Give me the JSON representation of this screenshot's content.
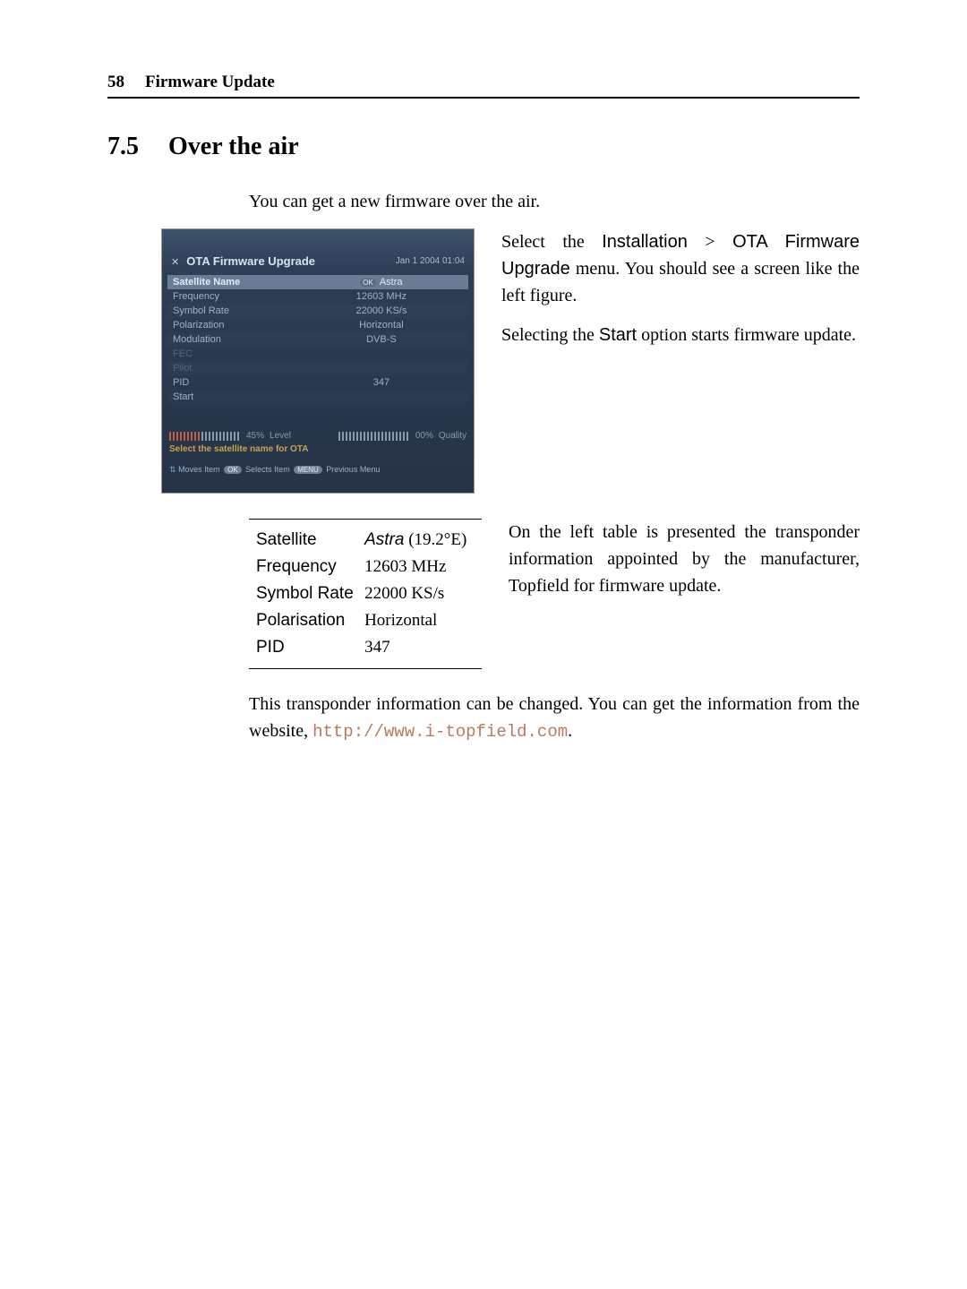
{
  "header": {
    "page_number": "58",
    "chapter_title": "Firmware Update"
  },
  "section": {
    "number": "7.5",
    "title": "Over the air"
  },
  "intro_text": "You can get a new firmware over the air.",
  "osd": {
    "title": "OTA Firmware Upgrade",
    "datetime": "Jan 1 2004 01:04",
    "ok_badge": "OK",
    "rows": {
      "satellite_name": {
        "label": "Satellite Name",
        "value": "Astra"
      },
      "frequency": {
        "label": "Frequency",
        "value": "12603 MHz"
      },
      "symbol_rate": {
        "label": "Symbol Rate",
        "value": "22000 KS/s"
      },
      "polarization": {
        "label": "Polarization",
        "value": "Horizontal"
      },
      "modulation": {
        "label": "Modulation",
        "value": "DVB-S"
      },
      "fec": {
        "label": "FEC",
        "value": ""
      },
      "pilot": {
        "label": "Pilot",
        "value": ""
      },
      "pid": {
        "label": "PID",
        "value": "347"
      },
      "start": {
        "label": "Start",
        "value": ""
      }
    },
    "level": {
      "label": "Level",
      "value": "45%",
      "fill_pct": 45
    },
    "quality": {
      "label": "Quality",
      "value": "00%",
      "fill_pct": 0
    },
    "help_line1": "Select the satellite name for OTA",
    "help_moves": "Moves Item",
    "help_selects": "Selects Item",
    "help_prev": "Previous Menu",
    "ok_label": "OK",
    "menu_label": "MENU"
  },
  "right1": {
    "p1_a": "Select the ",
    "p1_b": "Installation",
    "p1_c": " > ",
    "p1_d": "OTA Firmware Upgrade",
    "p1_e": " menu. You should see a screen like the left figure.",
    "p2_a": "Selecting the ",
    "p2_b": "Start",
    "p2_c": " option starts firmware update."
  },
  "info_table": {
    "satellite": {
      "label": "Satellite",
      "value_ital": "Astra",
      "value_rest": " (19.2°E)"
    },
    "frequency": {
      "label": "Frequency",
      "value": "12603 MHz"
    },
    "symbol_rate": {
      "label": "Symbol Rate",
      "value": "22000 KS/s"
    },
    "polarisation": {
      "label": "Polarisation",
      "value": "Horizontal"
    },
    "pid": {
      "label": "PID",
      "value": "347"
    }
  },
  "right2_text": "On the left table is presented the transponder information appointed by the manufacturer, Topfield for firmware update.",
  "bottom_para": {
    "a": "This transponder information can be changed. You can get the information from the website, ",
    "url": "http://www.i-topfield.com",
    "b": "."
  }
}
